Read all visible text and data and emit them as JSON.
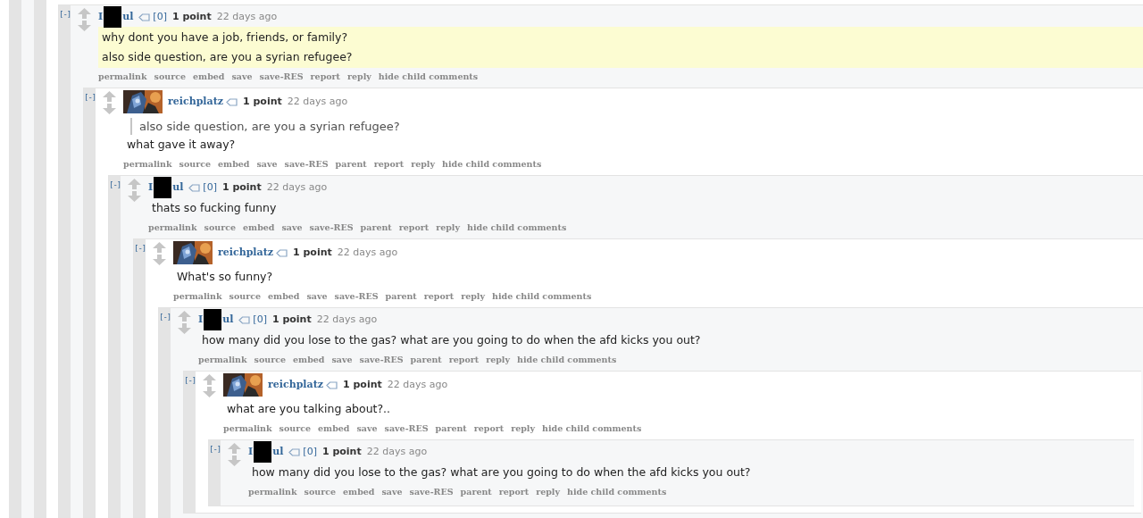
{
  "comments": [
    {
      "collapse_label": "[-]",
      "author": {
        "redacted": true,
        "visible_start": "I",
        "visible_end": "ul"
      },
      "vote_count": "[0]",
      "score": "1 point",
      "time": "22 days ago",
      "highlighted": true,
      "body": [
        {
          "kind": "text",
          "text": "why dont you have a job, friends, or family?"
        },
        {
          "kind": "text",
          "text": "also side question, are you a syrian refugee?"
        }
      ],
      "buttons": [
        "permalink",
        "source",
        "embed",
        "save",
        "save-RES",
        "report",
        "reply",
        "hide child comments"
      ],
      "children": [
        {
          "collapse_label": "[-]",
          "author": {
            "name": "reichplatz",
            "avatar": true
          },
          "score": "1 point",
          "time": "22 days ago",
          "body": [
            {
              "kind": "quote",
              "text": "also side question, are you a syrian refugee?"
            },
            {
              "kind": "text",
              "text": "what gave it away?"
            }
          ],
          "buttons": [
            "permalink",
            "source",
            "embed",
            "save",
            "save-RES",
            "parent",
            "report",
            "reply",
            "hide child comments"
          ],
          "children": [
            {
              "collapse_label": "[-]",
              "author": {
                "redacted": true,
                "visible_start": "I",
                "visible_end": "ul"
              },
              "vote_count": "[0]",
              "score": "1 point",
              "time": "22 days ago",
              "body": [
                {
                  "kind": "text",
                  "text": "thats so fucking funny"
                }
              ],
              "buttons": [
                "permalink",
                "source",
                "embed",
                "save",
                "save-RES",
                "parent",
                "report",
                "reply",
                "hide child comments"
              ],
              "children": [
                {
                  "collapse_label": "[-]",
                  "author": {
                    "name": "reichplatz",
                    "avatar": true
                  },
                  "score": "1 point",
                  "time": "22 days ago",
                  "body": [
                    {
                      "kind": "text",
                      "text": "What's so funny?"
                    }
                  ],
                  "buttons": [
                    "permalink",
                    "source",
                    "embed",
                    "save",
                    "save-RES",
                    "parent",
                    "report",
                    "reply",
                    "hide child comments"
                  ],
                  "children": [
                    {
                      "collapse_label": "[-]",
                      "author": {
                        "redacted": true,
                        "visible_start": "I",
                        "visible_end": "ul"
                      },
                      "vote_count": "[0]",
                      "score": "1 point",
                      "time": "22 days ago",
                      "body": [
                        {
                          "kind": "text",
                          "text": "how many did you lose to the gas? what are you going to do when the afd kicks you out?"
                        }
                      ],
                      "buttons": [
                        "permalink",
                        "source",
                        "embed",
                        "save",
                        "save-RES",
                        "parent",
                        "report",
                        "reply",
                        "hide child comments"
                      ],
                      "children": [
                        {
                          "collapse_label": "[-]",
                          "author": {
                            "name": "reichplatz",
                            "avatar": true
                          },
                          "score": "1 point",
                          "time": "22 days ago",
                          "body": [
                            {
                              "kind": "text",
                              "text": "what are you talking about?.."
                            }
                          ],
                          "buttons": [
                            "permalink",
                            "source",
                            "embed",
                            "save",
                            "save-RES",
                            "parent",
                            "report",
                            "reply",
                            "hide child comments"
                          ],
                          "children": [
                            {
                              "collapse_label": "[-]",
                              "author": {
                                "redacted": true,
                                "visible_start": "I",
                                "visible_end": "ul"
                              },
                              "vote_count": "[0]",
                              "score": "1 point",
                              "time": "22 days ago",
                              "body": [
                                {
                                  "kind": "text",
                                  "text": "how many did you lose to the gas? what are you going to do when the afd kicks you out?"
                                }
                              ],
                              "buttons": [
                                "permalink",
                                "source",
                                "embed",
                                "save",
                                "save-RES",
                                "parent",
                                "report",
                                "reply",
                                "hide child comments"
                              ]
                            }
                          ]
                        }
                      ]
                    }
                  ]
                }
              ]
            }
          ]
        }
      ]
    }
  ]
}
